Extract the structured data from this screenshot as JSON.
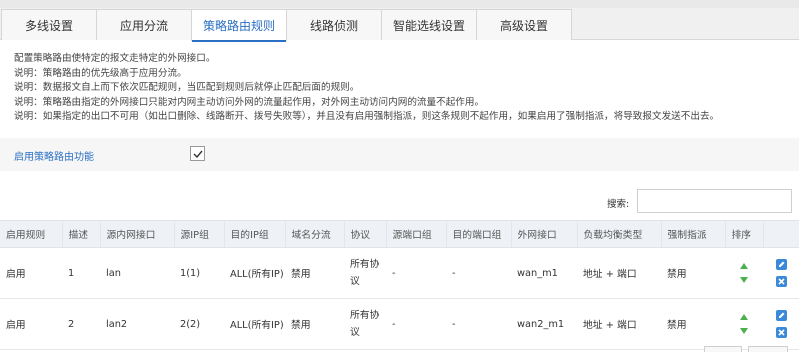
{
  "tabs": [
    {
      "label": "多线设置"
    },
    {
      "label": "应用分流"
    },
    {
      "label": "策略路由规则"
    },
    {
      "label": "线路侦测"
    },
    {
      "label": "智能选线设置"
    },
    {
      "label": "高级设置"
    }
  ],
  "notes": [
    "配置策略路由使特定的报文走特定的外网接口。",
    "说明：策略路由的优先级高于应用分流。",
    "说明：数据报文自上而下依次匹配规则，当匹配到规则后就停止匹配后面的规则。",
    "说明：策略路由指定的外网接口只能对内网主动访问外网的流量起作用，对外网主动访问内网的流量不起作用。",
    "说明：如果指定的出口不可用（如出口删除、线路断开、拨号失败等），并且没有启用强制指派，则这条规则不起作用，如果启用了强制指派，将导致报文发送不出去。"
  ],
  "enable": {
    "label": "启用策略路由功能",
    "checked": true
  },
  "search": {
    "label": "搜索:",
    "value": ""
  },
  "table": {
    "headers": [
      "启用规则",
      "描述",
      "源内网接口",
      "源IP组",
      "目的IP组",
      "域名分流",
      "协议",
      "源端口组",
      "目的端口组",
      "外网接口",
      "负载均衡类型",
      "强制指派",
      "排序",
      ""
    ],
    "rows": [
      {
        "enabled": "启用",
        "desc": "1",
        "src_if": "lan",
        "src_ip": "1(1)",
        "dst_ip": "ALL(所有IP)",
        "domain": "禁用",
        "proto": "所有协议",
        "src_port": "-",
        "dst_port": "-",
        "wan_if": "wan_m1",
        "lb_type": "地址 + 端口",
        "force": "禁用"
      },
      {
        "enabled": "启用",
        "desc": "2",
        "src_if": "lan2",
        "src_ip": "2(2)",
        "dst_ip": "ALL(所有IP)",
        "domain": "禁用",
        "proto": "所有协议",
        "src_port": "-",
        "dst_port": "-",
        "wan_if": "wan2_m1",
        "lb_type": "地址 + 端口",
        "force": "禁用"
      }
    ]
  },
  "colors": {
    "accent": "#2b6fc4",
    "sort_arrow": "#4caf50",
    "op_button": "#3b8ad9"
  }
}
